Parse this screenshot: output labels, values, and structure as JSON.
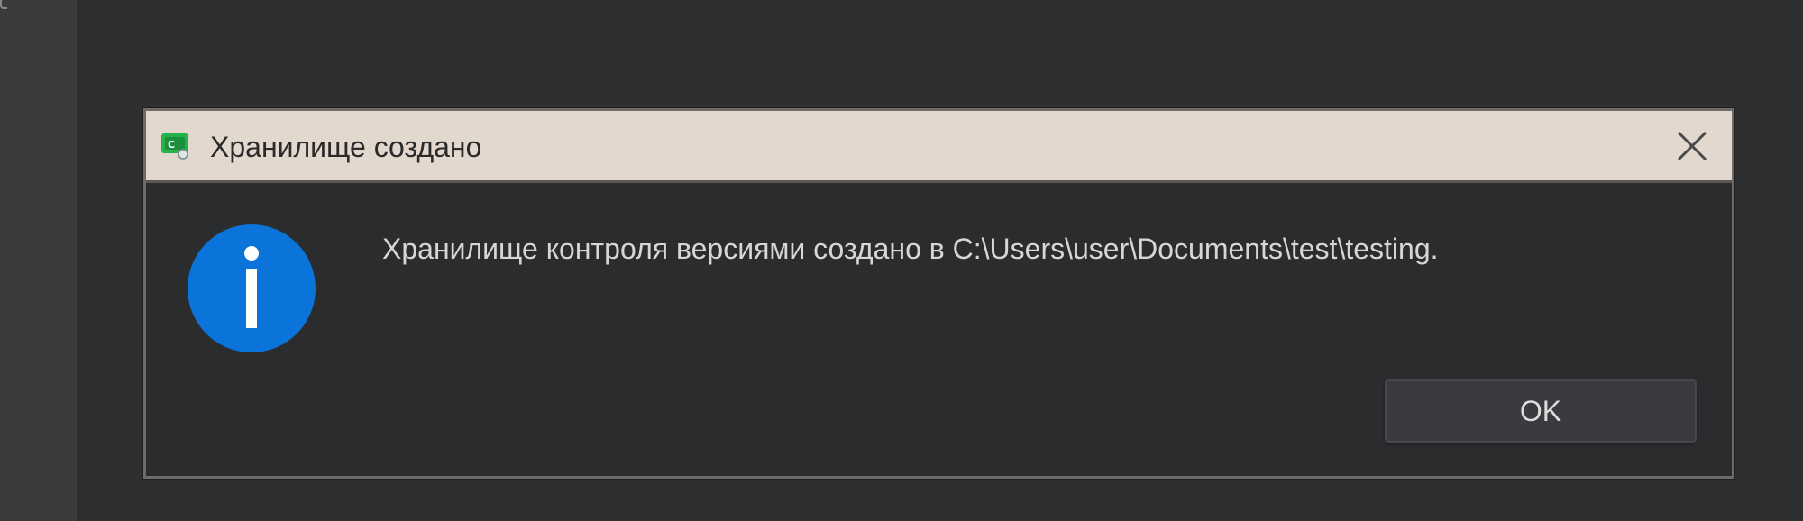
{
  "dialog": {
    "title": "Хранилище создано",
    "app_icon": "version-control-app-icon",
    "close_icon": "close-icon",
    "info_icon": "info-icon",
    "message": "Хранилище контроля версиями создано в C:\\Users\\user\\Documents\\test\\testing.",
    "ok_label": "OK"
  },
  "colors": {
    "titlebar": "#e3d8ce",
    "dialog_body": "#2b2c2e",
    "info_blue": "#0a74da",
    "background": "#2e2f31"
  }
}
